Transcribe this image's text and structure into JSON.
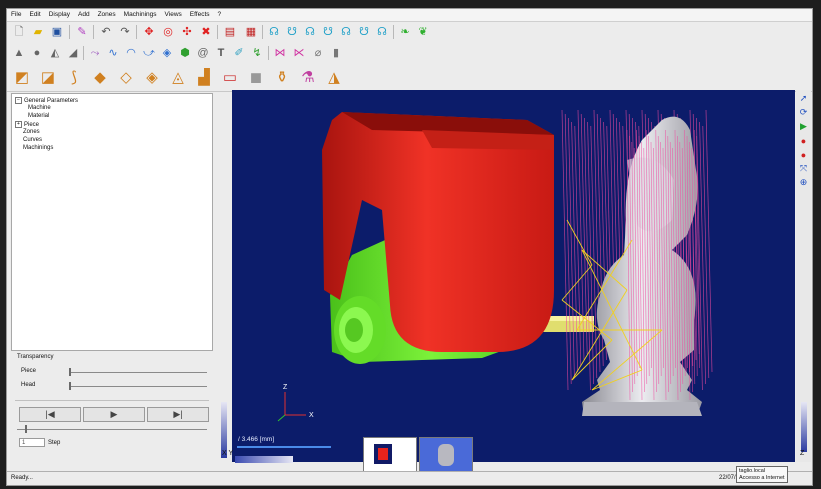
{
  "menu": [
    "File",
    "Edit",
    "Display",
    "Add",
    "Zones",
    "Machinings",
    "Views",
    "Effects",
    "?"
  ],
  "tree": {
    "root": "General Parameters",
    "children": [
      "Machine",
      "Material"
    ],
    "items": [
      "Piece",
      "Zones",
      "Curves",
      "Machinings"
    ]
  },
  "controls": {
    "transparency_label": "Transparency",
    "piece_label": "Piece",
    "head_label": "Head",
    "step_value": "1",
    "step_label": "Step",
    "prev_glyph": "|◀",
    "play_glyph": "▶",
    "next_glyph": "▶|"
  },
  "viewport": {
    "scale_text": "/ 3.466 [mm]",
    "axis_z": "Z",
    "axis_x": "X",
    "corner_xy": "X Y",
    "corner_z": "Z",
    "colors": {
      "background": "#0c1c6a",
      "head": "#e8231c",
      "spindle": "#6ef02a",
      "piece": "#c9c9cf",
      "tool": "#e8e070",
      "path_pink": "#f04aa0",
      "path_yellow": "#f0d020"
    }
  },
  "status": {
    "text": "Ready...",
    "date": "22/07/20",
    "tooltip_line1": "taglio.local",
    "tooltip_line2": "Accesso a Internet"
  },
  "icons": {
    "toolbar1": [
      "new-file-icon",
      "open-folder-icon",
      "save-icon",
      "magic-wand-icon",
      "undo-icon",
      "redo-icon",
      "move-icon",
      "rotate-icon",
      "pan-icon",
      "close-red-icon",
      "image-icon",
      "screenshot-icon",
      "view-front-icon",
      "view-back-icon",
      "view-left-icon",
      "view-right-icon",
      "view-top-icon",
      "view-bottom-icon",
      "view-iso-icon",
      "leaf-icon",
      "leaf-alt-icon"
    ],
    "toolbar2": [
      "cone-icon",
      "sphere-icon",
      "pyramid-icon",
      "slope-icon",
      "path-icon",
      "curve-icon",
      "arc-icon",
      "arrow-curve-icon",
      "surface-icon",
      "bead-icon",
      "spiral-icon",
      "text-t-icon",
      "pencil-icon",
      "cut-path-icon",
      "zigzag-icon",
      "polyline-icon",
      "drill-icon",
      "cylinder-icon"
    ],
    "toolbar3": [
      "roughing-icon",
      "finishing-icon",
      "contour-icon",
      "pocket-icon",
      "raster-icon",
      "slice-icon",
      "spiral-mill-icon",
      "step-icon",
      "plane-icon",
      "block-icon",
      "vase-icon",
      "lathe-icon",
      "cone-mill-icon"
    ],
    "right": [
      "select-cursor-icon",
      "refresh-icon",
      "play-green-icon",
      "record-red-icon",
      "stop-red-icon",
      "fit-view-icon",
      "center-target-icon"
    ]
  }
}
